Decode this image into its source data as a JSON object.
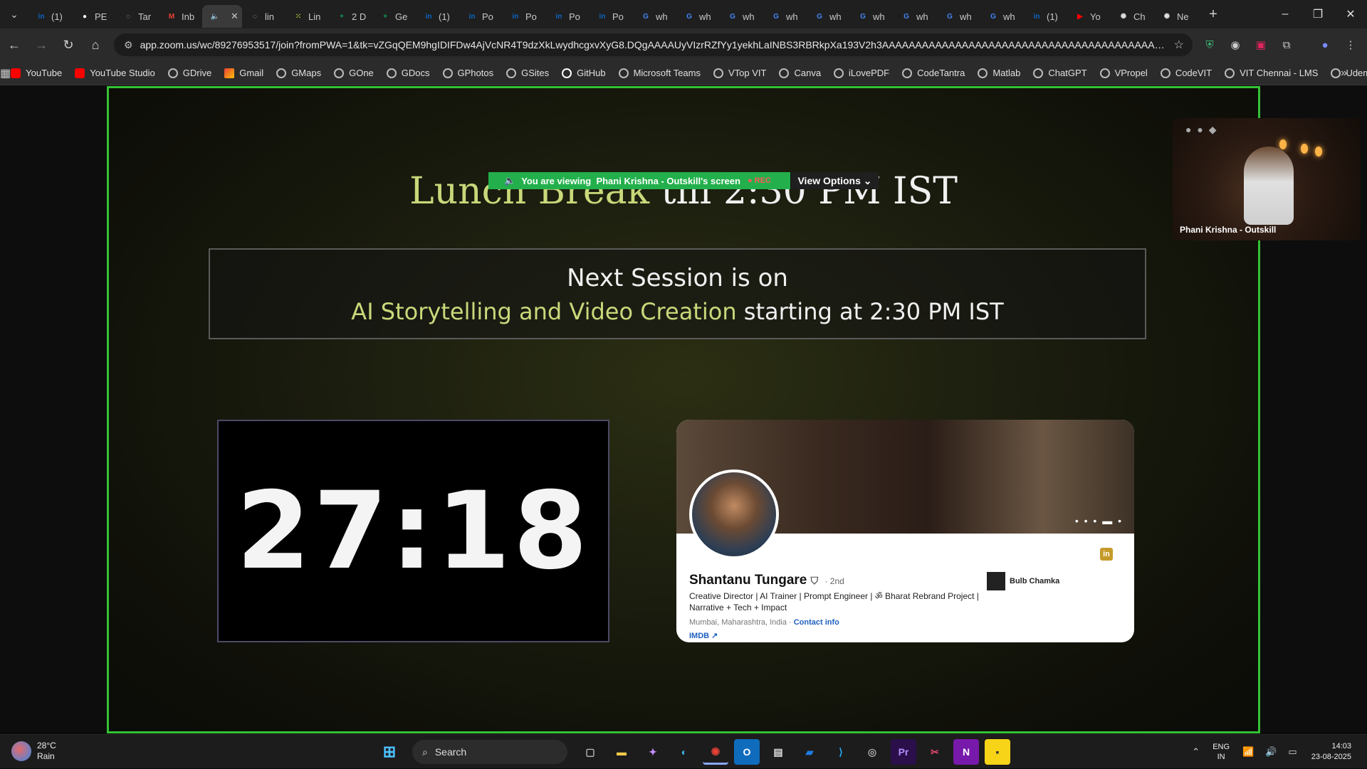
{
  "browser": {
    "tabs": [
      {
        "label": "(1)",
        "icon": "linkedin-icon",
        "color": "#0a66c2"
      },
      {
        "label": "PE",
        "icon": "github-icon",
        "color": "#ffffff"
      },
      {
        "label": "Tar",
        "icon": "globe-icon",
        "color": "#bbbbbb"
      },
      {
        "label": "Inb",
        "icon": "gmail-icon",
        "color": "#ea4335"
      },
      {
        "label": "",
        "icon": "speaker-icon",
        "color": "#dddddd",
        "active": true
      },
      {
        "label": "lin",
        "icon": "globe-icon",
        "color": "#bbbbbb"
      },
      {
        "label": "Lin",
        "icon": "grid-icon",
        "color": "#c8d73a"
      },
      {
        "label": "2 D",
        "icon": "sheets-icon",
        "color": "#0f9d58"
      },
      {
        "label": "Ge",
        "icon": "sheets-icon",
        "color": "#0f9d58"
      },
      {
        "label": "(1)",
        "icon": "linkedin-icon",
        "color": "#0a66c2"
      },
      {
        "label": "Po",
        "icon": "linkedin-icon",
        "color": "#0a66c2"
      },
      {
        "label": "Po",
        "icon": "linkedin-icon",
        "color": "#0a66c2"
      },
      {
        "label": "Po",
        "icon": "linkedin-icon",
        "color": "#0a66c2"
      },
      {
        "label": "Po",
        "icon": "linkedin-icon",
        "color": "#0a66c2"
      },
      {
        "label": "wh",
        "icon": "google-icon",
        "color": "#4285f4"
      },
      {
        "label": "wh",
        "icon": "google-icon",
        "color": "#4285f4"
      },
      {
        "label": "wh",
        "icon": "google-icon",
        "color": "#4285f4"
      },
      {
        "label": "wh",
        "icon": "google-icon",
        "color": "#4285f4"
      },
      {
        "label": "wh",
        "icon": "google-icon",
        "color": "#4285f4"
      },
      {
        "label": "wh",
        "icon": "google-icon",
        "color": "#4285f4"
      },
      {
        "label": "wh",
        "icon": "google-icon",
        "color": "#4285f4"
      },
      {
        "label": "wh",
        "icon": "google-icon",
        "color": "#4285f4"
      },
      {
        "label": "wh",
        "icon": "google-icon",
        "color": "#4285f4"
      },
      {
        "label": "(1)",
        "icon": "linkedin-icon",
        "color": "#0a66c2"
      },
      {
        "label": "Yo",
        "icon": "youtube-icon",
        "color": "#ff0000"
      },
      {
        "label": "Ch",
        "icon": "chatgpt-icon",
        "color": "#dddddd"
      },
      {
        "label": "Ne",
        "icon": "chatgpt-icon",
        "color": "#dddddd"
      }
    ],
    "url": "app.zoom.us/wc/89276953517/join?fromPWA=1&tk=vZGqQEM9hgIDIFDw4AjVcNR4T9dzXkLwydhcgxvXyG8.DQgAAAAUyVIzrRZfYy1yekhLaINBS3RBRkpXa193V2h3AAAAAAAAAAAAAAAAAAAAAAAAAAAAAAAAAAAAAAAAAAAA&_x_zm_r...",
    "bookmarks": [
      "YouTube",
      "YouTube Studio",
      "GDrive",
      "Gmail",
      "GMaps",
      "GOne",
      "GDocs",
      "GPhotos",
      "GSites",
      "GitHub",
      "Microsoft Teams",
      "VTop VIT",
      "Canva",
      "iLovePDF",
      "CodeTantra",
      "Matlab",
      "ChatGPT",
      "VPropel",
      "CodeVIT",
      "VIT Chennai - LMS",
      "Udemy"
    ]
  },
  "zoom": {
    "banner_text": "You are viewing",
    "banner_name": "Phani Krishna - Outskill's screen",
    "rec_label": "REC",
    "view_options": "View Options",
    "self_view_name": "Phani Krishna - Outskill"
  },
  "slide": {
    "title_highlight": "Lunch Break",
    "title_rest": "till 2:30 PM IST",
    "next_line1": "Next Session is on",
    "next_topic": "AI Storytelling and Video Creation",
    "next_rest": "starting at 2:30 PM IST",
    "timer": "27:18"
  },
  "profile_card": {
    "name": "Shantanu Tungare",
    "degree": "· 2nd",
    "headline": "Creative Director | AI Trainer | Prompt Engineer | ॐ Bharat Rebrand Project | Narrative + Tech + Impact",
    "location": "Mumbai, Maharashtra, India ·",
    "contact": "Contact info",
    "link": "IMDB",
    "company": "Bulb Chamka"
  },
  "taskbar": {
    "weather_temp": "28°C",
    "weather_desc": "Rain",
    "search_placeholder": "Search",
    "lang_top": "ENG",
    "lang_bottom": "IN",
    "time": "14:03",
    "date": "23-08-2025"
  }
}
